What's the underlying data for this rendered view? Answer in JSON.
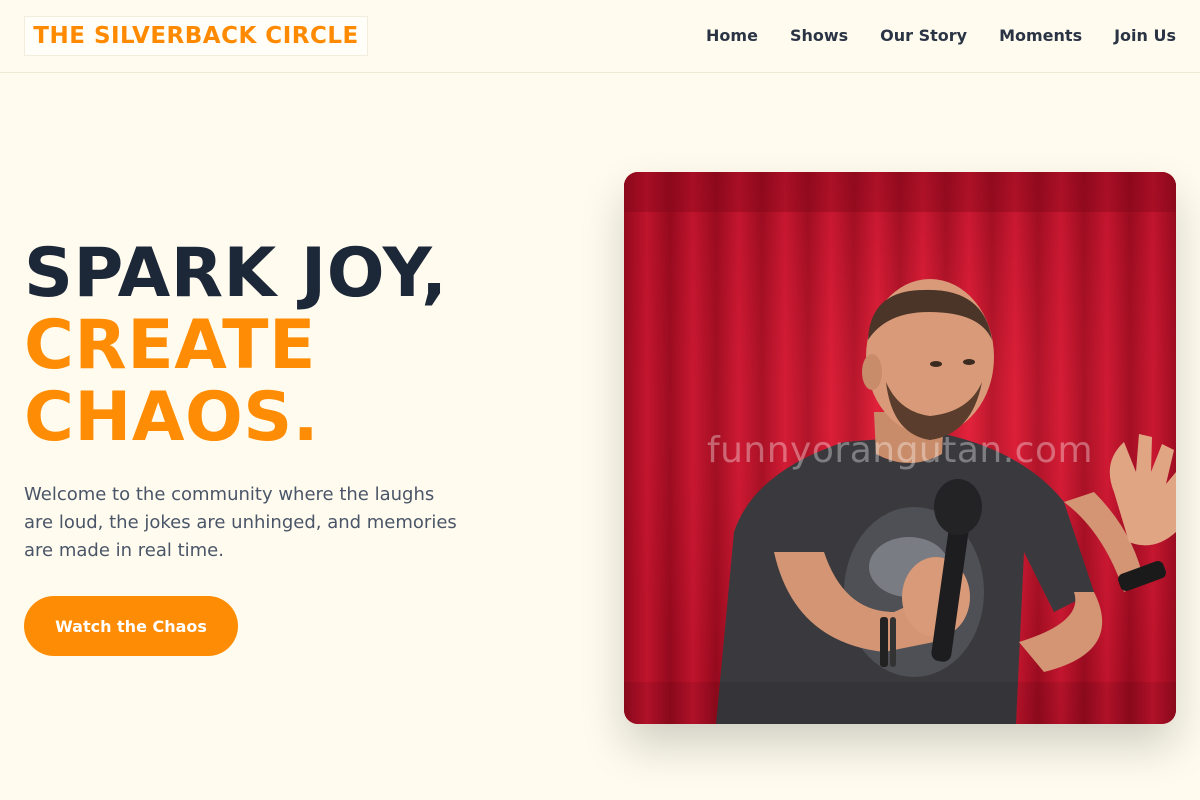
{
  "header": {
    "logo_text": "THE SILVERBACK CIRCLE",
    "nav": [
      {
        "label": "Home"
      },
      {
        "label": "Shows"
      },
      {
        "label": "Our Story"
      },
      {
        "label": "Moments"
      },
      {
        "label": "Join Us"
      }
    ]
  },
  "hero": {
    "title_line_1": "SPARK JOY,",
    "title_line_2": "CREATE",
    "title_line_3": "CHAOS.",
    "description": "Welcome to the community where the laughs are loud, the jokes are unhinged, and memories are made in real time.",
    "cta_label": "Watch the Chaos",
    "image": {
      "subject": "comedian-on-stage-with-microphone",
      "watermark": "funnyorangutan.com"
    }
  },
  "colors": {
    "background": "#fffcef",
    "accent": "#ff8c05",
    "title_dark": "#1c2738",
    "text_body": "#4a5568",
    "nav_text": "#2a3444",
    "curtain_red": "#c3122a"
  }
}
